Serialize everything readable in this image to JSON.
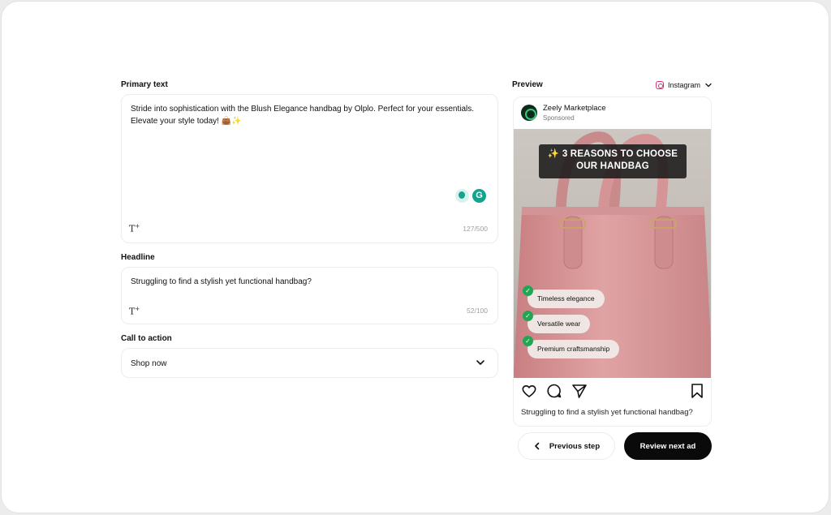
{
  "primary_text": {
    "label": "Primary text",
    "value": "Stride into sophistication with the Blush Elegance handbag by Olplo. Perfect for your essentials. Elevate your style today! 👜✨",
    "counter": "127/500",
    "tool_icon": "text-ai-icon"
  },
  "headline": {
    "label": "Headline",
    "value": "Struggling to find a stylish yet functional handbag?",
    "counter": "52/100"
  },
  "cta": {
    "label": "Call to action",
    "value": "Shop now"
  },
  "preview": {
    "label": "Preview",
    "platform": "Instagram",
    "account_name": "Zeely Marketplace",
    "account_sub": "Sponsored",
    "overlay_title": "✨ 3 REASONS TO CHOOSE OUR HANDBAG",
    "benefits": [
      "Timeless elegance",
      "Versatile wear",
      "Premium craftsmanship"
    ],
    "caption": "Struggling to find a stylish yet functional handbag?",
    "colors": {
      "bag": "#dc9a9b",
      "check": "#22a654",
      "dark": "#0a0a0a"
    }
  },
  "nav": {
    "previous": "Previous step",
    "next": "Review next ad"
  }
}
